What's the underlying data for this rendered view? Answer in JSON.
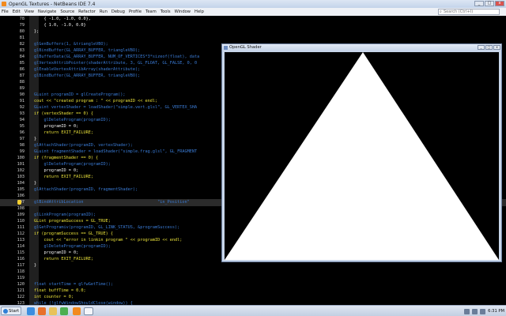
{
  "window": {
    "title": "OpenGL Textures - NetBeans IDE 7.4",
    "controls": [
      "_",
      "□",
      "x"
    ]
  },
  "menubar": {
    "items": [
      "File",
      "Edit",
      "View",
      "Navigate",
      "Source",
      "Refactor",
      "Run",
      "Debug",
      "Profile",
      "Team",
      "Tools",
      "Window",
      "Help"
    ],
    "search_placeholder": "Search (Ctrl+I)"
  },
  "editor": {
    "lines": [
      {
        "n": "78",
        "t": "    { -1.0, -1.0, 0.0},"
      },
      {
        "n": "79",
        "t": "    { 1.0, -1.0, 0.0}"
      },
      {
        "n": "80",
        "t": "};"
      },
      {
        "n": "81",
        "t": ""
      },
      {
        "n": "82",
        "t": "glGenBuffers(1, &triangleVBO);"
      },
      {
        "n": "83",
        "t": "glBindBuffer(GL_ARRAY_BUFFER, triangleVBO);"
      },
      {
        "n": "84",
        "t": "glBufferData(GL_ARRAY_BUFFER, NUM_OF_VERTICES*3*sizeof(float), data"
      },
      {
        "n": "85",
        "t": "glVertexAttribPointer(shaderAttribute, 3, GL_FLOAT, GL_FALSE, 0, 0"
      },
      {
        "n": "86",
        "t": "glEnableVertexAttribArray(shaderAttribute);"
      },
      {
        "n": "87",
        "t": "glBindBuffer(GL_ARRAY_BUFFER, triangleVBO);"
      },
      {
        "n": "88",
        "t": ""
      },
      {
        "n": "89",
        "t": ""
      },
      {
        "n": "90",
        "t": "GLuint programID = glCreateProgram();"
      },
      {
        "n": "91",
        "t": "cout << \"created program : \" << programID << endl;"
      },
      {
        "n": "92",
        "t": "GLuint vertexShader = loadShader(\"simple.vert.glsl\", GL_VERTEX_SHA"
      },
      {
        "n": "93",
        "t": "if (vertexShader == 0) {"
      },
      {
        "n": "94",
        "t": "    glDeleteProgram(programID);"
      },
      {
        "n": "95",
        "t": "    programID = 0;"
      },
      {
        "n": "96",
        "t": "    return EXIT_FAILURE;"
      },
      {
        "n": "97",
        "t": "}"
      },
      {
        "n": "98",
        "t": "glAttachShader(programID, vertexShader);"
      },
      {
        "n": "99",
        "t": "GLuint fragmentShader = loadShader(\"simple.frag.glsl\", GL_FRAGMENT"
      },
      {
        "n": "100",
        "t": "if (fragmentShader == 0) {"
      },
      {
        "n": "101",
        "t": "    glDeleteProgram(programID);"
      },
      {
        "n": "102",
        "t": "    programID = 0;"
      },
      {
        "n": "103",
        "t": "    return EXIT_FAILURE;"
      },
      {
        "n": "104",
        "t": "}"
      },
      {
        "n": "105",
        "t": "glAttachShader(programID, fragmentShader);"
      },
      {
        "n": "106",
        "t": ""
      },
      {
        "n": "107",
        "t": "glBindAttribLocation                              \"in_Position\""
      },
      {
        "n": "108",
        "t": ""
      },
      {
        "n": "109",
        "t": "glLinkProgram(programID);"
      },
      {
        "n": "110",
        "t": "GLint programSuccess = GL_TRUE;"
      },
      {
        "n": "111",
        "t": "glGetProgramiv(programID, GL_LINK_STATUS, &programSuccess);"
      },
      {
        "n": "112",
        "t": "if (programSuccess == GL_TRUE) {"
      },
      {
        "n": "113",
        "t": "    cout << \"error in linkin program \" << programID << endl;"
      },
      {
        "n": "114",
        "t": "    glDeleteProgram(programID);"
      },
      {
        "n": "115",
        "t": "    programID = 0;"
      },
      {
        "n": "116",
        "t": "    return EXIT_FAILURE;"
      },
      {
        "n": "117",
        "t": "}"
      },
      {
        "n": "118",
        "t": ""
      },
      {
        "n": "119",
        "t": ""
      },
      {
        "n": "120",
        "t": "float startTime = glfwGetTime();"
      },
      {
        "n": "121",
        "t": "float buffTime = 0.0;"
      },
      {
        "n": "122",
        "t": "int counter = 0;"
      },
      {
        "n": "123",
        "t": "while (!glfwWindowShouldClose(window)) {"
      }
    ],
    "highlighted_line": "107"
  },
  "gl_window": {
    "title": "OpenGL Shader",
    "controls": [
      "_",
      "□",
      "x"
    ],
    "triangle_color": "#ffffff",
    "background": "#000000"
  },
  "taskbar": {
    "start_label": "Start",
    "clock": "6:31 PM",
    "accent": "#2f7fd6"
  }
}
